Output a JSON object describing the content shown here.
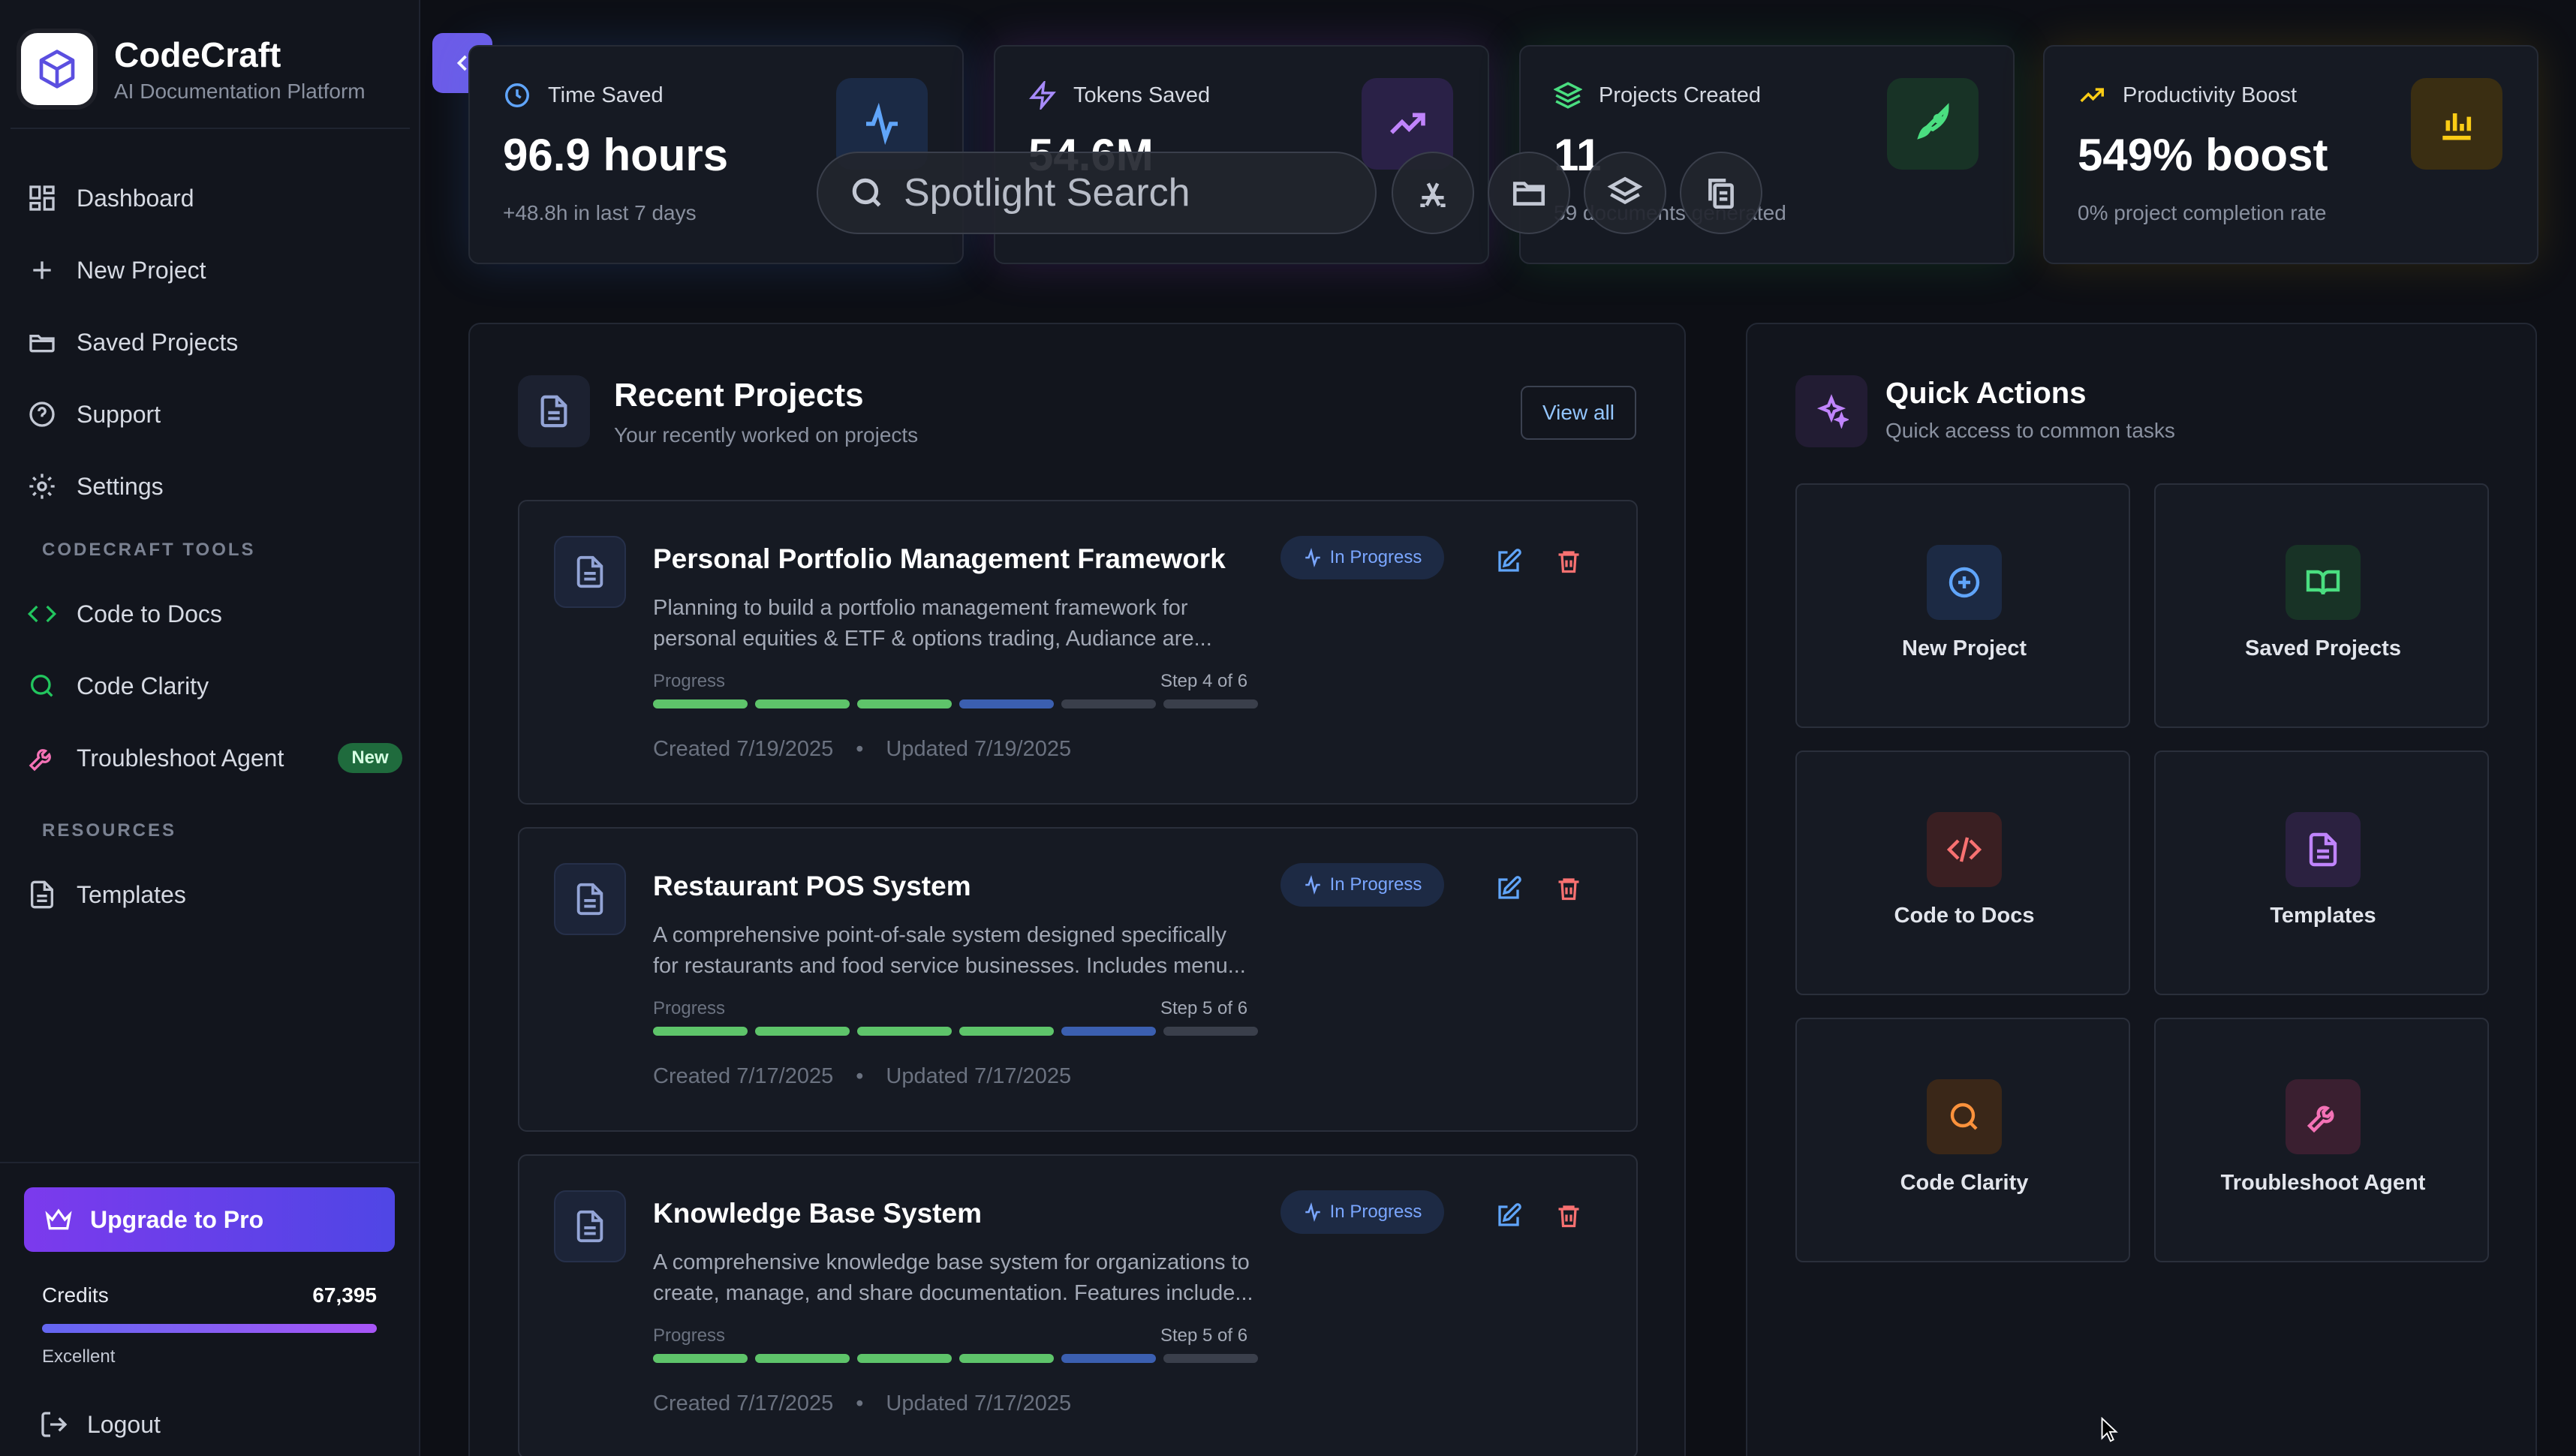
{
  "brand": {
    "title": "CodeCraft",
    "subtitle": "AI Documentation Platform"
  },
  "nav": {
    "main": [
      {
        "label": "Dashboard",
        "icon": "dashboard-icon"
      },
      {
        "label": "New Project",
        "icon": "plus-icon"
      },
      {
        "label": "Saved Projects",
        "icon": "folder-open-icon"
      },
      {
        "label": "Support",
        "icon": "help-circle-icon"
      },
      {
        "label": "Settings",
        "icon": "gear-icon"
      }
    ],
    "tools_label": "CODECRAFT TOOLS",
    "tools": [
      {
        "label": "Code to Docs",
        "icon": "code-icon"
      },
      {
        "label": "Code Clarity",
        "icon": "search-icon"
      },
      {
        "label": "Troubleshoot Agent",
        "icon": "wrench-icon",
        "badge": "New"
      }
    ],
    "resources_label": "RESOURCES",
    "resources": [
      {
        "label": "Templates",
        "icon": "file-text-icon"
      }
    ]
  },
  "sidebar_bottom": {
    "upgrade_label": "Upgrade to Pro",
    "credits_label": "Credits",
    "credits_value": "67,395",
    "credits_status": "Excellent",
    "logout_label": "Logout"
  },
  "stats": [
    {
      "title": "Time Saved",
      "value": "96.9 hours",
      "sub": "+48.8h in last 7 days"
    },
    {
      "title": "Tokens Saved",
      "value": "54.6M",
      "sub": ""
    },
    {
      "title": "Projects Created",
      "value": "11",
      "sub": "59 documents generated"
    },
    {
      "title": "Productivity Boost",
      "value": "549% boost",
      "sub": "0% project completion rate"
    }
  ],
  "spotlight": {
    "placeholder": "Spotlight Search"
  },
  "recent": {
    "title": "Recent Projects",
    "subtitle": "Your recently worked on projects",
    "view_all": "View all",
    "progress_label": "Progress",
    "projects": [
      {
        "title": "Personal Portfolio Management Framework",
        "desc": "Planning to build a portfolio management framework for personal equities & ETF & options trading, Audiance are...",
        "status": "In Progress",
        "step": "Step 4 of 6",
        "created": "Created 7/19/2025",
        "updated": "Updated 7/19/2025",
        "step_current": 4,
        "step_total": 6
      },
      {
        "title": "Restaurant POS System",
        "desc": "A comprehensive point-of-sale system designed specifically for restaurants and food service businesses. Includes menu...",
        "status": "In Progress",
        "step": "Step 5 of 6",
        "created": "Created 7/17/2025",
        "updated": "Updated 7/17/2025",
        "step_current": 5,
        "step_total": 6
      },
      {
        "title": "Knowledge Base System",
        "desc": "A comprehensive knowledge base system for organizations to create, manage, and share documentation. Features include...",
        "status": "In Progress",
        "step": "Step 5 of 6",
        "created": "Created 7/17/2025",
        "updated": "Updated 7/17/2025",
        "step_current": 5,
        "step_total": 6
      }
    ]
  },
  "quick": {
    "title": "Quick Actions",
    "subtitle": "Quick access to common tasks",
    "actions": [
      {
        "label": "New Project",
        "icon": "plus-circle-icon",
        "color": "#60a5fa"
      },
      {
        "label": "Saved Projects",
        "icon": "book-open-icon",
        "color": "#4ade80"
      },
      {
        "label": "Code to Docs",
        "icon": "code-icon",
        "color": "#f87171"
      },
      {
        "label": "Templates",
        "icon": "file-text-icon",
        "color": "#c084fc"
      },
      {
        "label": "Code Clarity",
        "icon": "search-icon",
        "color": "#fb923c"
      },
      {
        "label": "Troubleshoot Agent",
        "icon": "wrench-icon",
        "color": "#f472b6"
      }
    ]
  },
  "colors": {
    "accent": "#6d5ce8",
    "progress_done": "#5ec46a",
    "progress_current": "#3b5fb0"
  }
}
